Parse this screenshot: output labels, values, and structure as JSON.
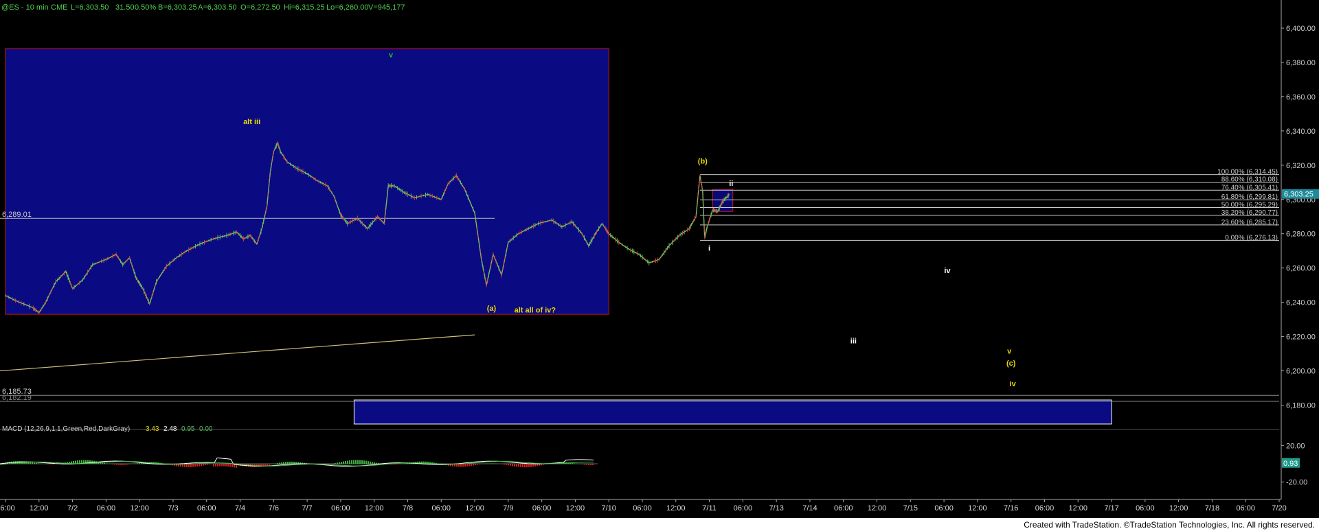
{
  "header": {
    "symbol": "@ES - 10 min",
    "exchange": "CME",
    "last": "L=6,303.50",
    "change": "31.50",
    "change_pct": "0.50%",
    "bid": "B=6,303.25",
    "ask": "A=6,303.50",
    "open": "O=6,272.50",
    "high": "Hi=6,315.25",
    "low": "Lo=6,260.00",
    "volume": "V=945,177"
  },
  "footer": {
    "credit": "Created with TradeStation. ©TradeStation Technologies, Inc. All rights reserved."
  },
  "colors": {
    "background": "#000000",
    "box_fill": "#0a0a82",
    "box_border": "#c01818",
    "wave_yellow": "#e8d800",
    "wave_white": "#ffffff",
    "wave_green": "#20c020",
    "price_flag": "#1f8a9a",
    "macd_flag": "#1f9a8a",
    "trendline": "#cbbf7a"
  },
  "chart_data": {
    "type": "line",
    "title": "",
    "price_axis": {
      "ticks": [
        6400,
        6380,
        6360,
        6340,
        6320,
        6300,
        6280,
        6260,
        6240,
        6220,
        6200,
        6180
      ],
      "tick_labels": [
        "6,400.00",
        "6,380.00",
        "6,360.00",
        "6,340.00",
        "6,320.00",
        "6,300.00",
        "6,280.00",
        "6,260.00",
        "6,240.00",
        "6,220.00",
        "6,200.00",
        "6,180.00"
      ],
      "range": [
        6169,
        6410
      ],
      "last_price": 6303.25,
      "last_price_label": "6,303.25"
    },
    "time_axis": {
      "labels": [
        "06:00",
        "12:00",
        "7/2",
        "06:00",
        "12:00",
        "7/3",
        "06:00",
        "7/4",
        "7/6",
        "7/7",
        "06:00",
        "12:00",
        "7/8",
        "06:00",
        "12:00",
        "7/9",
        "06:00",
        "12:00",
        "7/10",
        "06:00",
        "12:00",
        "7/11",
        "06:00",
        "7/13",
        "7/14",
        "06:00",
        "12:00",
        "7/15",
        "06:00",
        "12:00",
        "7/16",
        "06:00",
        "12:00",
        "7/17",
        "06:00",
        "12:00",
        "7/18",
        "06:00",
        "7/20"
      ]
    },
    "horizontal_levels": [
      {
        "value": 6289.01,
        "label": "6,289.01"
      },
      {
        "value": 6185.73,
        "label": "6,185.73"
      },
      {
        "value": 6182.19,
        "label": "6,182.19"
      }
    ],
    "fib_levels": [
      {
        "value": 6314.45,
        "label": "100.00% (6,314.45)"
      },
      {
        "value": 6310.08,
        "label": "88.60% (6,310.08)"
      },
      {
        "value": 6305.41,
        "label": "76.40% (6,305.41)"
      },
      {
        "value": 6299.81,
        "label": "61.80% (6,299.81)"
      },
      {
        "value": 6295.29,
        "label": "50.00% (6,295.29)"
      },
      {
        "value": 6290.77,
        "label": "38.20% (6,290.77)"
      },
      {
        "value": 6285.17,
        "label": "23.60% (6,285.17)"
      },
      {
        "value": 6276.13,
        "label": "0.00% (6,276.13)"
      }
    ],
    "price_series": [
      {
        "t": 0,
        "p": 6244
      },
      {
        "t": 0.3,
        "p": 6241
      },
      {
        "t": 0.8,
        "p": 6237
      },
      {
        "t": 1,
        "p": 6234
      },
      {
        "t": 1.2,
        "p": 6240
      },
      {
        "t": 1.5,
        "p": 6252
      },
      {
        "t": 1.8,
        "p": 6258
      },
      {
        "t": 2,
        "p": 6248
      },
      {
        "t": 2.3,
        "p": 6253
      },
      {
        "t": 2.6,
        "p": 6262
      },
      {
        "t": 3,
        "p": 6265
      },
      {
        "t": 3.3,
        "p": 6268
      },
      {
        "t": 3.5,
        "p": 6262
      },
      {
        "t": 3.7,
        "p": 6266
      },
      {
        "t": 3.9,
        "p": 6254
      },
      {
        "t": 4.1,
        "p": 6248
      },
      {
        "t": 4.3,
        "p": 6239
      },
      {
        "t": 4.5,
        "p": 6252
      },
      {
        "t": 4.8,
        "p": 6261
      },
      {
        "t": 5.1,
        "p": 6266
      },
      {
        "t": 5.4,
        "p": 6270
      },
      {
        "t": 5.8,
        "p": 6274
      },
      {
        "t": 6.2,
        "p": 6277
      },
      {
        "t": 6.6,
        "p": 6279
      },
      {
        "t": 6.9,
        "p": 6281
      },
      {
        "t": 7.1,
        "p": 6277
      },
      {
        "t": 7.3,
        "p": 6279
      },
      {
        "t": 7.5,
        "p": 6274
      },
      {
        "t": 7.65,
        "p": 6283
      },
      {
        "t": 7.8,
        "p": 6296
      },
      {
        "t": 7.9,
        "p": 6316
      },
      {
        "t": 8,
        "p": 6328
      },
      {
        "t": 8.12,
        "p": 6333
      },
      {
        "t": 8.2,
        "p": 6328
      },
      {
        "t": 8.4,
        "p": 6322
      },
      {
        "t": 8.7,
        "p": 6318
      },
      {
        "t": 9,
        "p": 6315
      },
      {
        "t": 9.3,
        "p": 6311
      },
      {
        "t": 9.6,
        "p": 6308
      },
      {
        "t": 9.8,
        "p": 6302
      },
      {
        "t": 10,
        "p": 6291
      },
      {
        "t": 10.2,
        "p": 6286
      },
      {
        "t": 10.5,
        "p": 6289
      },
      {
        "t": 10.8,
        "p": 6283
      },
      {
        "t": 11.1,
        "p": 6290
      },
      {
        "t": 11.3,
        "p": 6286
      },
      {
        "t": 11.42,
        "p": 6308
      },
      {
        "t": 11.6,
        "p": 6308
      },
      {
        "t": 11.9,
        "p": 6304
      },
      {
        "t": 12.2,
        "p": 6301
      },
      {
        "t": 12.6,
        "p": 6303
      },
      {
        "t": 13,
        "p": 6300
      },
      {
        "t": 13.2,
        "p": 6309
      },
      {
        "t": 13.45,
        "p": 6314
      },
      {
        "t": 13.7,
        "p": 6306
      },
      {
        "t": 14,
        "p": 6292
      },
      {
        "t": 14.2,
        "p": 6265
      },
      {
        "t": 14.35,
        "p": 6250
      },
      {
        "t": 14.55,
        "p": 6268
      },
      {
        "t": 14.8,
        "p": 6256
      },
      {
        "t": 15,
        "p": 6275
      },
      {
        "t": 15.3,
        "p": 6280
      },
      {
        "t": 15.6,
        "p": 6283
      },
      {
        "t": 15.9,
        "p": 6286
      },
      {
        "t": 16.3,
        "p": 6288
      },
      {
        "t": 16.6,
        "p": 6284
      },
      {
        "t": 16.9,
        "p": 6287
      },
      {
        "t": 17.2,
        "p": 6280
      },
      {
        "t": 17.4,
        "p": 6273
      },
      {
        "t": 17.6,
        "p": 6280
      },
      {
        "t": 17.8,
        "p": 6286
      },
      {
        "t": 18,
        "p": 6280
      },
      {
        "t": 18.3,
        "p": 6275
      },
      {
        "t": 18.6,
        "p": 6271
      },
      {
        "t": 18.9,
        "p": 6268
      },
      {
        "t": 19.2,
        "p": 6263
      },
      {
        "t": 19.5,
        "p": 6265
      },
      {
        "t": 19.8,
        "p": 6273
      },
      {
        "t": 20.1,
        "p": 6279
      },
      {
        "t": 20.4,
        "p": 6283
      },
      {
        "t": 20.6,
        "p": 6290
      },
      {
        "t": 20.72,
        "p": 6314
      },
      {
        "t": 20.8,
        "p": 6305
      },
      {
        "t": 20.86,
        "p": 6278
      },
      {
        "t": 20.95,
        "p": 6285
      },
      {
        "t": 21.1,
        "p": 6294
      },
      {
        "t": 21.25,
        "p": 6293
      },
      {
        "t": 21.4,
        "p": 6299
      },
      {
        "t": 21.55,
        "p": 6302
      },
      {
        "t": 21.6,
        "p": 6303
      }
    ],
    "wave_labels": [
      {
        "text": "v",
        "t": 11.5,
        "p": 6383,
        "color": "green"
      },
      {
        "text": "alt iii",
        "t": 7.35,
        "p": 6344,
        "color": "yellow"
      },
      {
        "text": "(b)",
        "t": 20.8,
        "p": 6321,
        "color": "yellow"
      },
      {
        "text": "ii",
        "t": 21.65,
        "p": 6308,
        "color": "white"
      },
      {
        "text": "i",
        "t": 21,
        "p": 6270,
        "color": "white"
      },
      {
        "text": "iv",
        "t": 28.1,
        "p": 6257,
        "color": "white"
      },
      {
        "text": "(a)",
        "t": 14.5,
        "p": 6235,
        "color": "yellow"
      },
      {
        "text": "alt all of iv?",
        "t": 15.8,
        "p": 6234,
        "color": "yellow"
      },
      {
        "text": "iii",
        "t": 25.3,
        "p": 6216,
        "color": "white"
      },
      {
        "text": "v",
        "t": 29.95,
        "p": 6210,
        "color": "yellow"
      },
      {
        "text": "(c)",
        "t": 30,
        "p": 6203,
        "color": "yellow"
      },
      {
        "text": "iv",
        "t": 30.05,
        "p": 6191,
        "color": "yellow"
      }
    ],
    "zones": [
      {
        "name": "upper-box",
        "t1": 0,
        "t2": 18,
        "p1": 6233,
        "p2": 6388
      },
      {
        "name": "lower-box",
        "t1": 10.4,
        "t2": 33,
        "p1": 6169,
        "p2": 6183
      },
      {
        "name": "small-box",
        "t1": 21.1,
        "t2": 21.7,
        "p1": 6293,
        "p2": 6306
      }
    ],
    "trendline": {
      "t1": 0,
      "p1": 6200,
      "t2": 14,
      "p2": 6221
    },
    "macd": {
      "label": "MACD (12,26,9,1,1,Green,Red,DarkGray)",
      "values": [
        "3.43",
        "2.48",
        "0.95",
        "0.00"
      ],
      "axis_labels": [
        "20.00",
        "-20.00"
      ],
      "axis_values": [
        20,
        -20
      ],
      "range": [
        -33,
        33
      ],
      "current_label": "0.93",
      "current_value": 0.93
    }
  }
}
